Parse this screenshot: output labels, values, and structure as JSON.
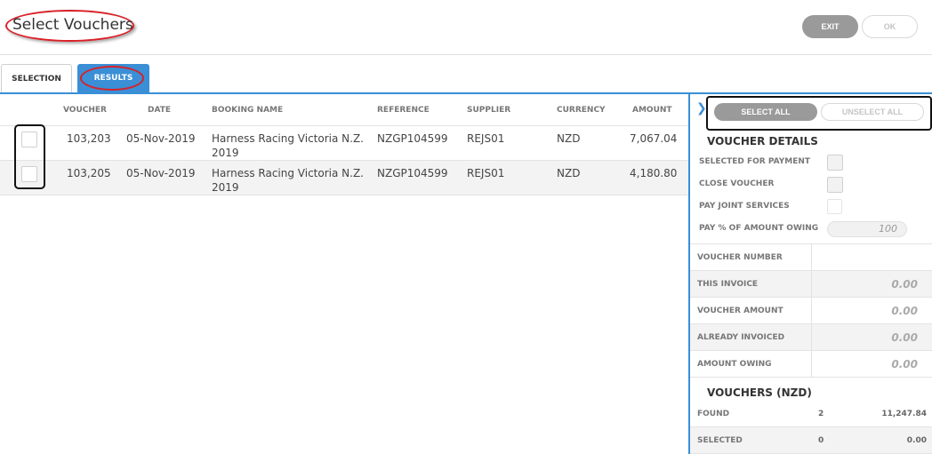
{
  "header": {
    "title": "Select Vouchers",
    "exit_label": "EXIT",
    "ok_label": "OK"
  },
  "tabs": [
    {
      "label": "SELECTION",
      "active": false
    },
    {
      "label": "RESULTS",
      "active": true
    }
  ],
  "results_table": {
    "columns": [
      "VOUCHER",
      "DATE",
      "BOOKING NAME",
      "REFERENCE",
      "SUPPLIER",
      "CURRENCY",
      "AMOUNT"
    ],
    "rows": [
      {
        "checked": false,
        "voucher": "103,203",
        "date": "05-Nov-2019",
        "booking_name_line1": "Harness Racing Victoria N.Z.",
        "booking_name_line2": "2019",
        "reference": "NZGP104599",
        "supplier": "REJS01",
        "currency": "NZD",
        "amount": "7,067.04"
      },
      {
        "checked": false,
        "voucher": "103,205",
        "date": "05-Nov-2019",
        "booking_name_line1": "Harness Racing Victoria N.Z.",
        "booking_name_line2": "2019",
        "reference": "NZGP104599",
        "supplier": "REJS01",
        "currency": "NZD",
        "amount": "4,180.80"
      }
    ]
  },
  "side_panel": {
    "select_all_label": "SELECT ALL",
    "unselect_all_label": "UNSELECT ALL",
    "voucher_details_title": "VOUCHER DETAILS",
    "selected_for_payment_label": "SELECTED FOR PAYMENT",
    "close_voucher_label": "CLOSE VOUCHER",
    "pay_joint_services_label": "PAY JOINT SERVICES",
    "pay_percent_label": "PAY % OF AMOUNT OWING",
    "pay_percent_value": "100",
    "details": [
      {
        "label": "VOUCHER NUMBER",
        "value": ""
      },
      {
        "label": "THIS INVOICE",
        "value": "0.00"
      },
      {
        "label": "VOUCHER AMOUNT",
        "value": "0.00"
      },
      {
        "label": "ALREADY INVOICED",
        "value": "0.00"
      },
      {
        "label": "AMOUNT OWING",
        "value": "0.00"
      }
    ],
    "vouchers_title": "VOUCHERS (NZD)",
    "vouchers": [
      {
        "label": "FOUND",
        "count": "2",
        "amount": "11,247.84"
      },
      {
        "label": "SELECTED",
        "count": "0",
        "amount": "0.00"
      }
    ]
  },
  "colors": {
    "accent": "#3a8fd6",
    "annotation_red": "#d92027",
    "annotation_black": "#111111"
  }
}
